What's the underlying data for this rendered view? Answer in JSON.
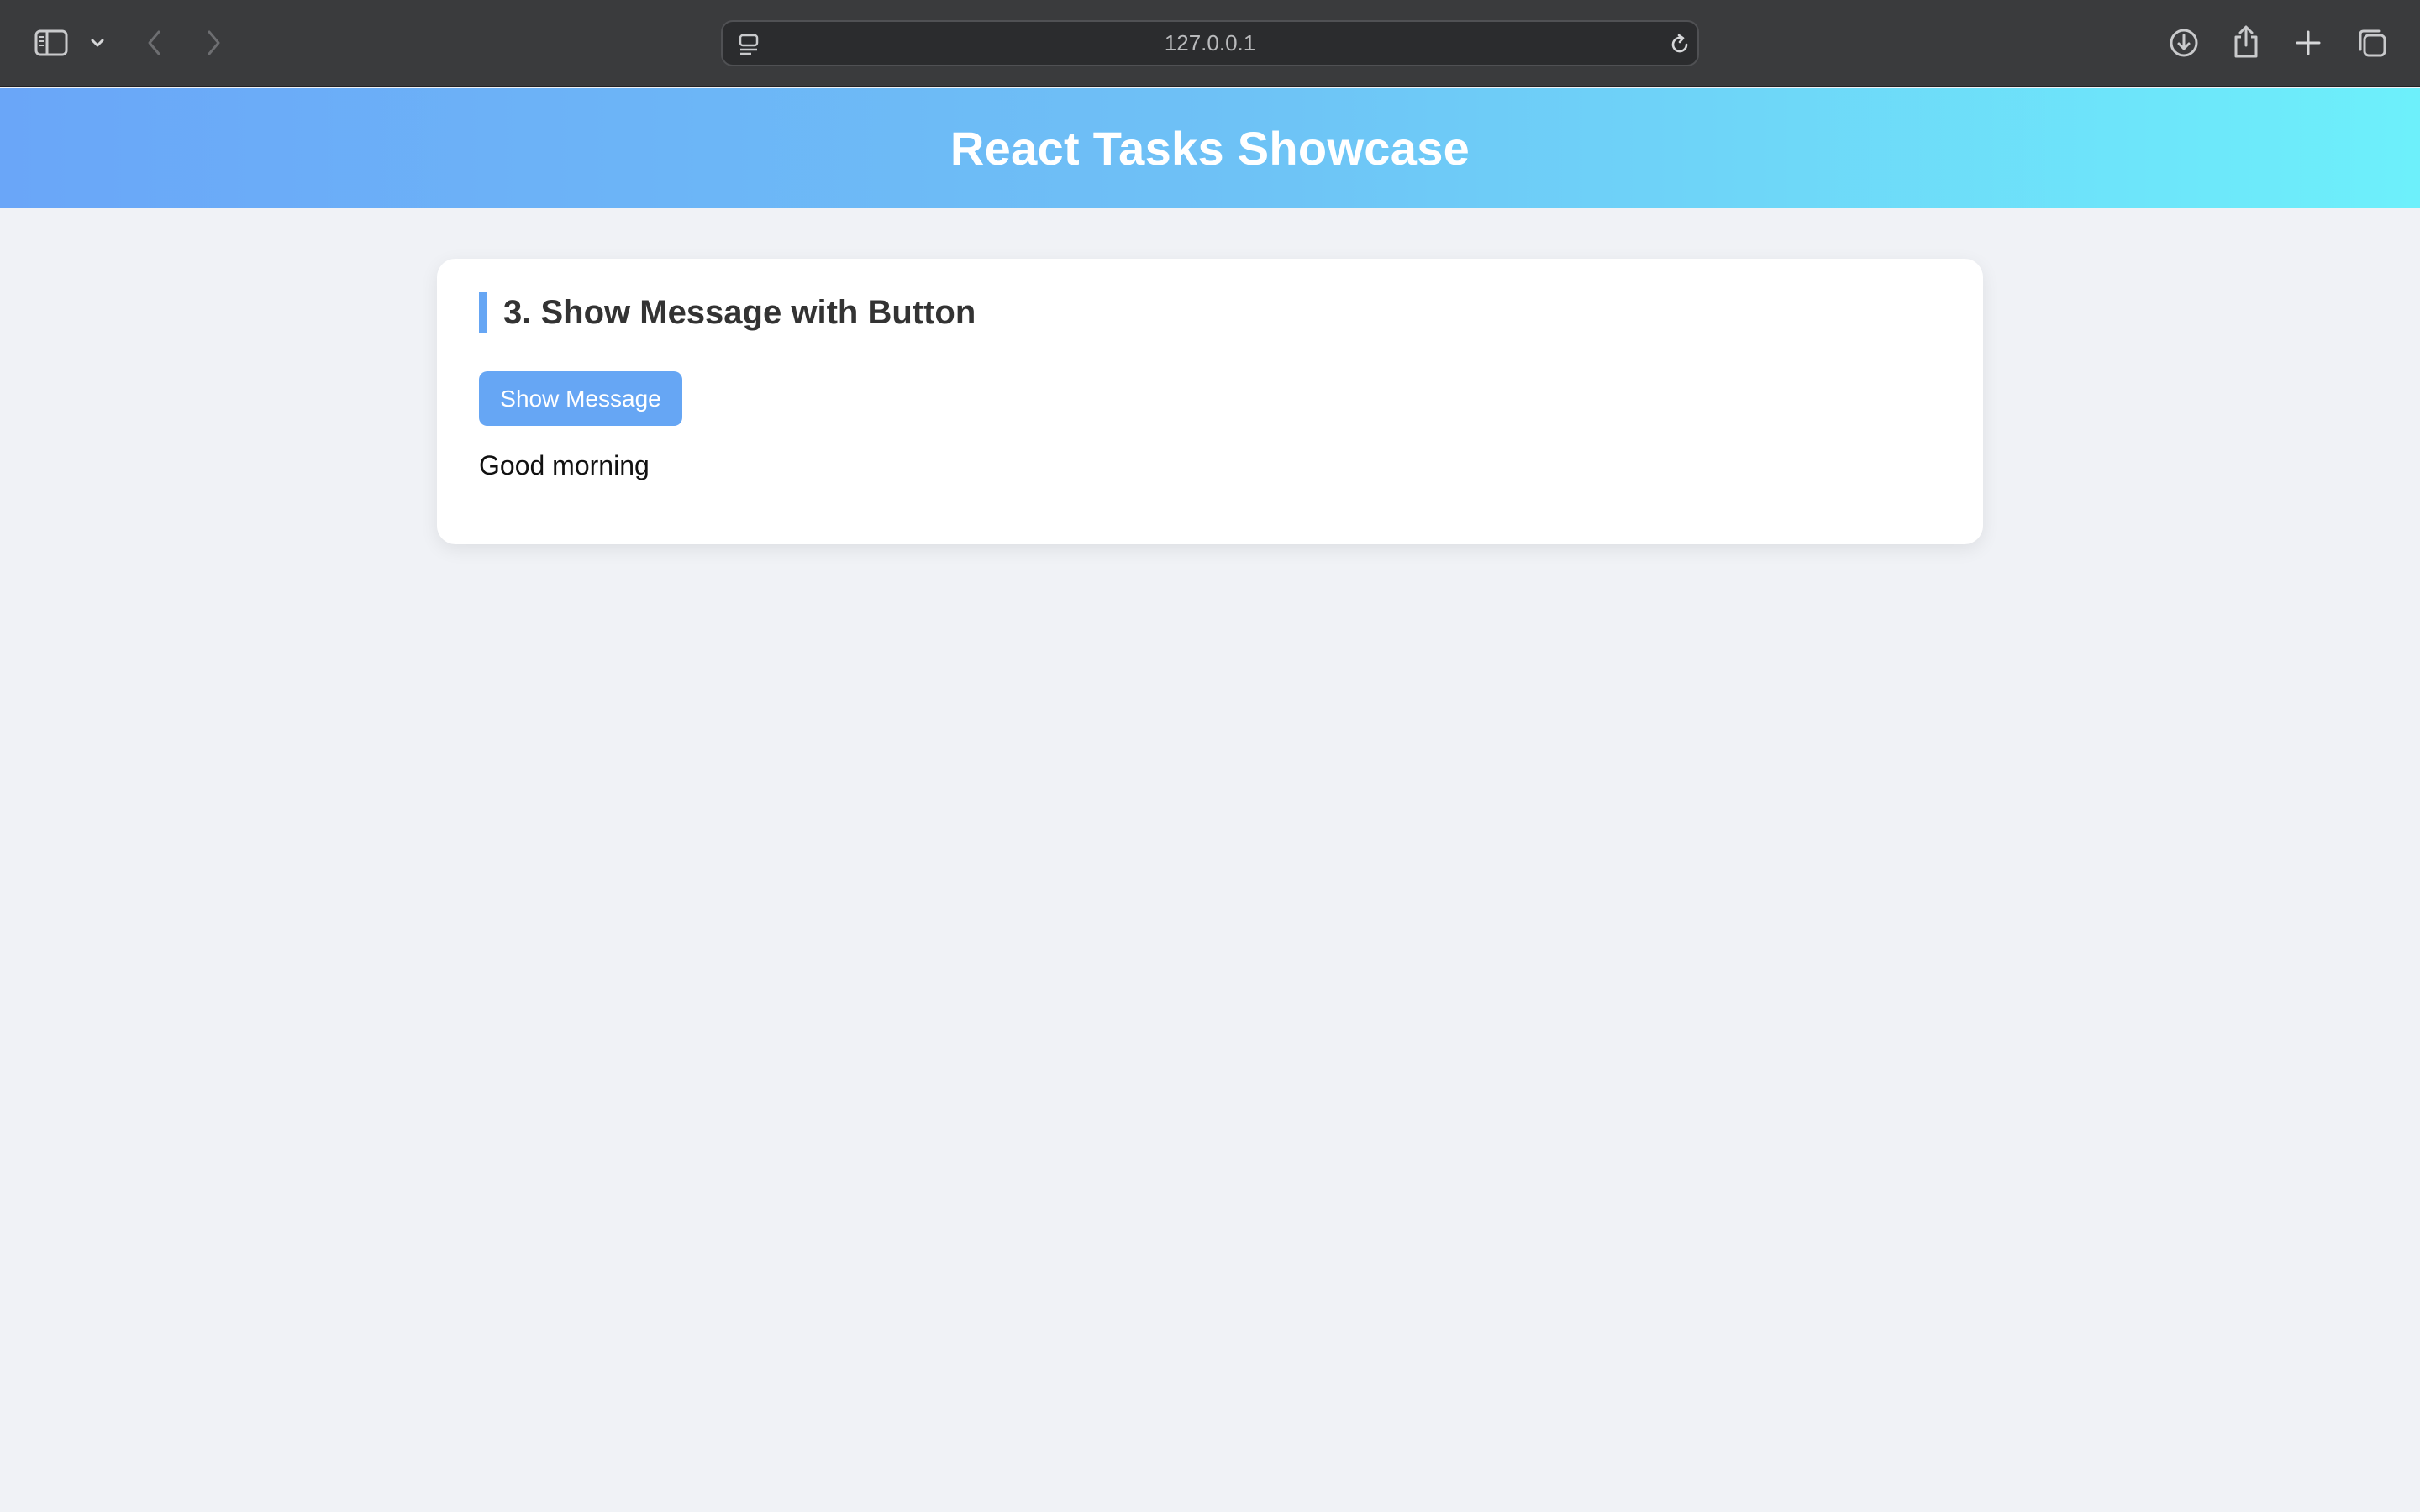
{
  "browser": {
    "address": "127.0.0.1",
    "icons": {
      "sidebar": "sidebar-icon",
      "sidebar_menu": "chevron-down-icon",
      "back": "chevron-left-icon",
      "forward": "chevron-right-icon",
      "reader": "reader-icon",
      "reload": "reload-icon",
      "download": "download-icon",
      "share": "share-icon",
      "new_tab": "plus-icon",
      "tabs": "tabs-overview-icon"
    }
  },
  "page": {
    "title": "React Tasks Showcase",
    "header_gradient": [
      "#6aa6f8",
      "#6df0fb"
    ]
  },
  "task": {
    "title": "3. Show Message with Button",
    "button_label": "Show Message",
    "message": "Good morning",
    "accent_color": "#66a6f4"
  }
}
